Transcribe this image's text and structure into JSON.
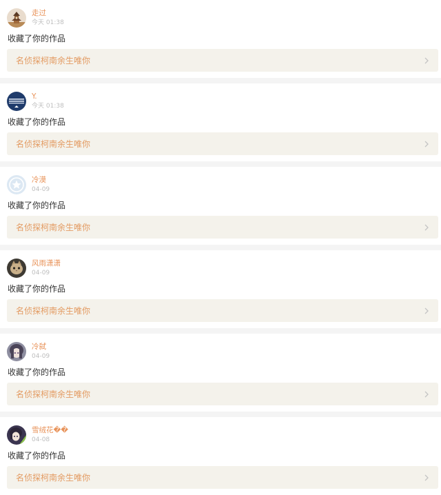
{
  "notifications": [
    {
      "user": "走过",
      "time": "今天 01:38",
      "action": "收藏了你的作品",
      "work_title": "名侦探柯南余生唯你",
      "avatar_icon": "avatar-pagoda-icon"
    },
    {
      "user": "Y.",
      "time": "今天 01:38",
      "action": "收藏了你的作品",
      "work_title": "名侦探柯南余生唯你",
      "avatar_icon": "avatar-navy-circle-icon"
    },
    {
      "user": "冷漠",
      "time": "04-09",
      "action": "收藏了你的作品",
      "work_title": "名侦探柯南余生唯你",
      "avatar_icon": "avatar-default-star-icon"
    },
    {
      "user": "风雨潇潇",
      "time": "04-09",
      "action": "收藏了你的作品",
      "work_title": "名侦探柯南余生唯你",
      "avatar_icon": "avatar-cat-icon"
    },
    {
      "user": "冷弑",
      "time": "04-09",
      "action": "收藏了你的作品",
      "work_title": "名侦探柯南余生唯你",
      "avatar_icon": "avatar-anime-girl-icon"
    },
    {
      "user": "雪绒花��",
      "time": "04-08",
      "action": "收藏了你的作品",
      "work_title": "名侦探柯南余生唯你",
      "avatar_icon": "avatar-anime-boy-icon"
    }
  ],
  "colors": {
    "username": "#e8935a",
    "work_title": "#e39b62",
    "work_link_bg": "#f4f2eb",
    "divider": "#f4f4f4"
  }
}
